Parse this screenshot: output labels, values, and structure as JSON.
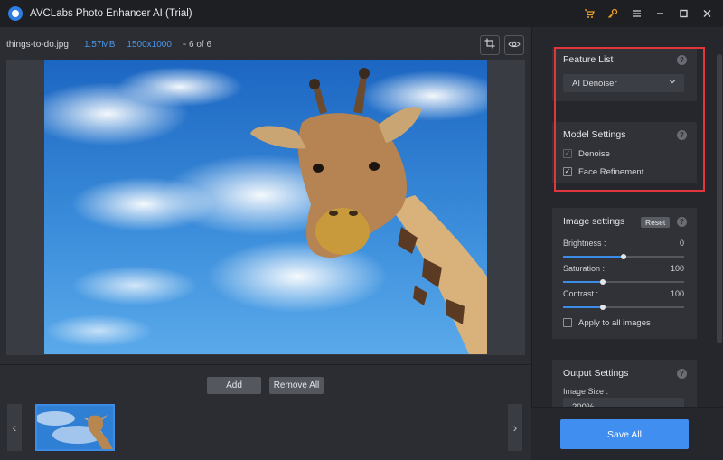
{
  "window": {
    "title": "AVCLabs Photo Enhancer AI (Trial)",
    "icons": [
      "cart-icon",
      "key-icon",
      "menu-icon",
      "minimize-icon",
      "maximize-icon",
      "close-icon"
    ]
  },
  "info": {
    "file_name": "things-to-do.jpg",
    "file_size": "1.57MB",
    "resolution": "1500x1000",
    "position": "- 6 of 6"
  },
  "preview_tools": {
    "icons": [
      "crop-icon",
      "eye-icon"
    ]
  },
  "actions": {
    "add_label": "Add",
    "remove_all_label": "Remove All"
  },
  "feature_list": {
    "title": "Feature List",
    "selected": "AI Denoiser"
  },
  "model_settings": {
    "title": "Model Settings",
    "options": [
      {
        "label": "Denoise",
        "checked": true,
        "disabled": true
      },
      {
        "label": "Face Refinement",
        "checked": true,
        "disabled": false
      }
    ]
  },
  "image_settings": {
    "title": "Image settings",
    "reset_label": "Reset",
    "sliders": [
      {
        "label": "Brightness :",
        "value": "0",
        "fraction": 0.5
      },
      {
        "label": "Saturation :",
        "value": "100",
        "fraction": 0.33
      },
      {
        "label": "Contrast :",
        "value": "100",
        "fraction": 0.33
      }
    ],
    "apply_all_label": "Apply to all images",
    "apply_all_checked": false
  },
  "output_settings": {
    "title": "Output Settings",
    "image_size_label": "Image Size :",
    "image_size_value": "200%"
  },
  "save_all_label": "Save All",
  "colors": {
    "accent": "#3c8be6",
    "highlight": "#e0363c",
    "brand_orange": "#f0a12c"
  }
}
